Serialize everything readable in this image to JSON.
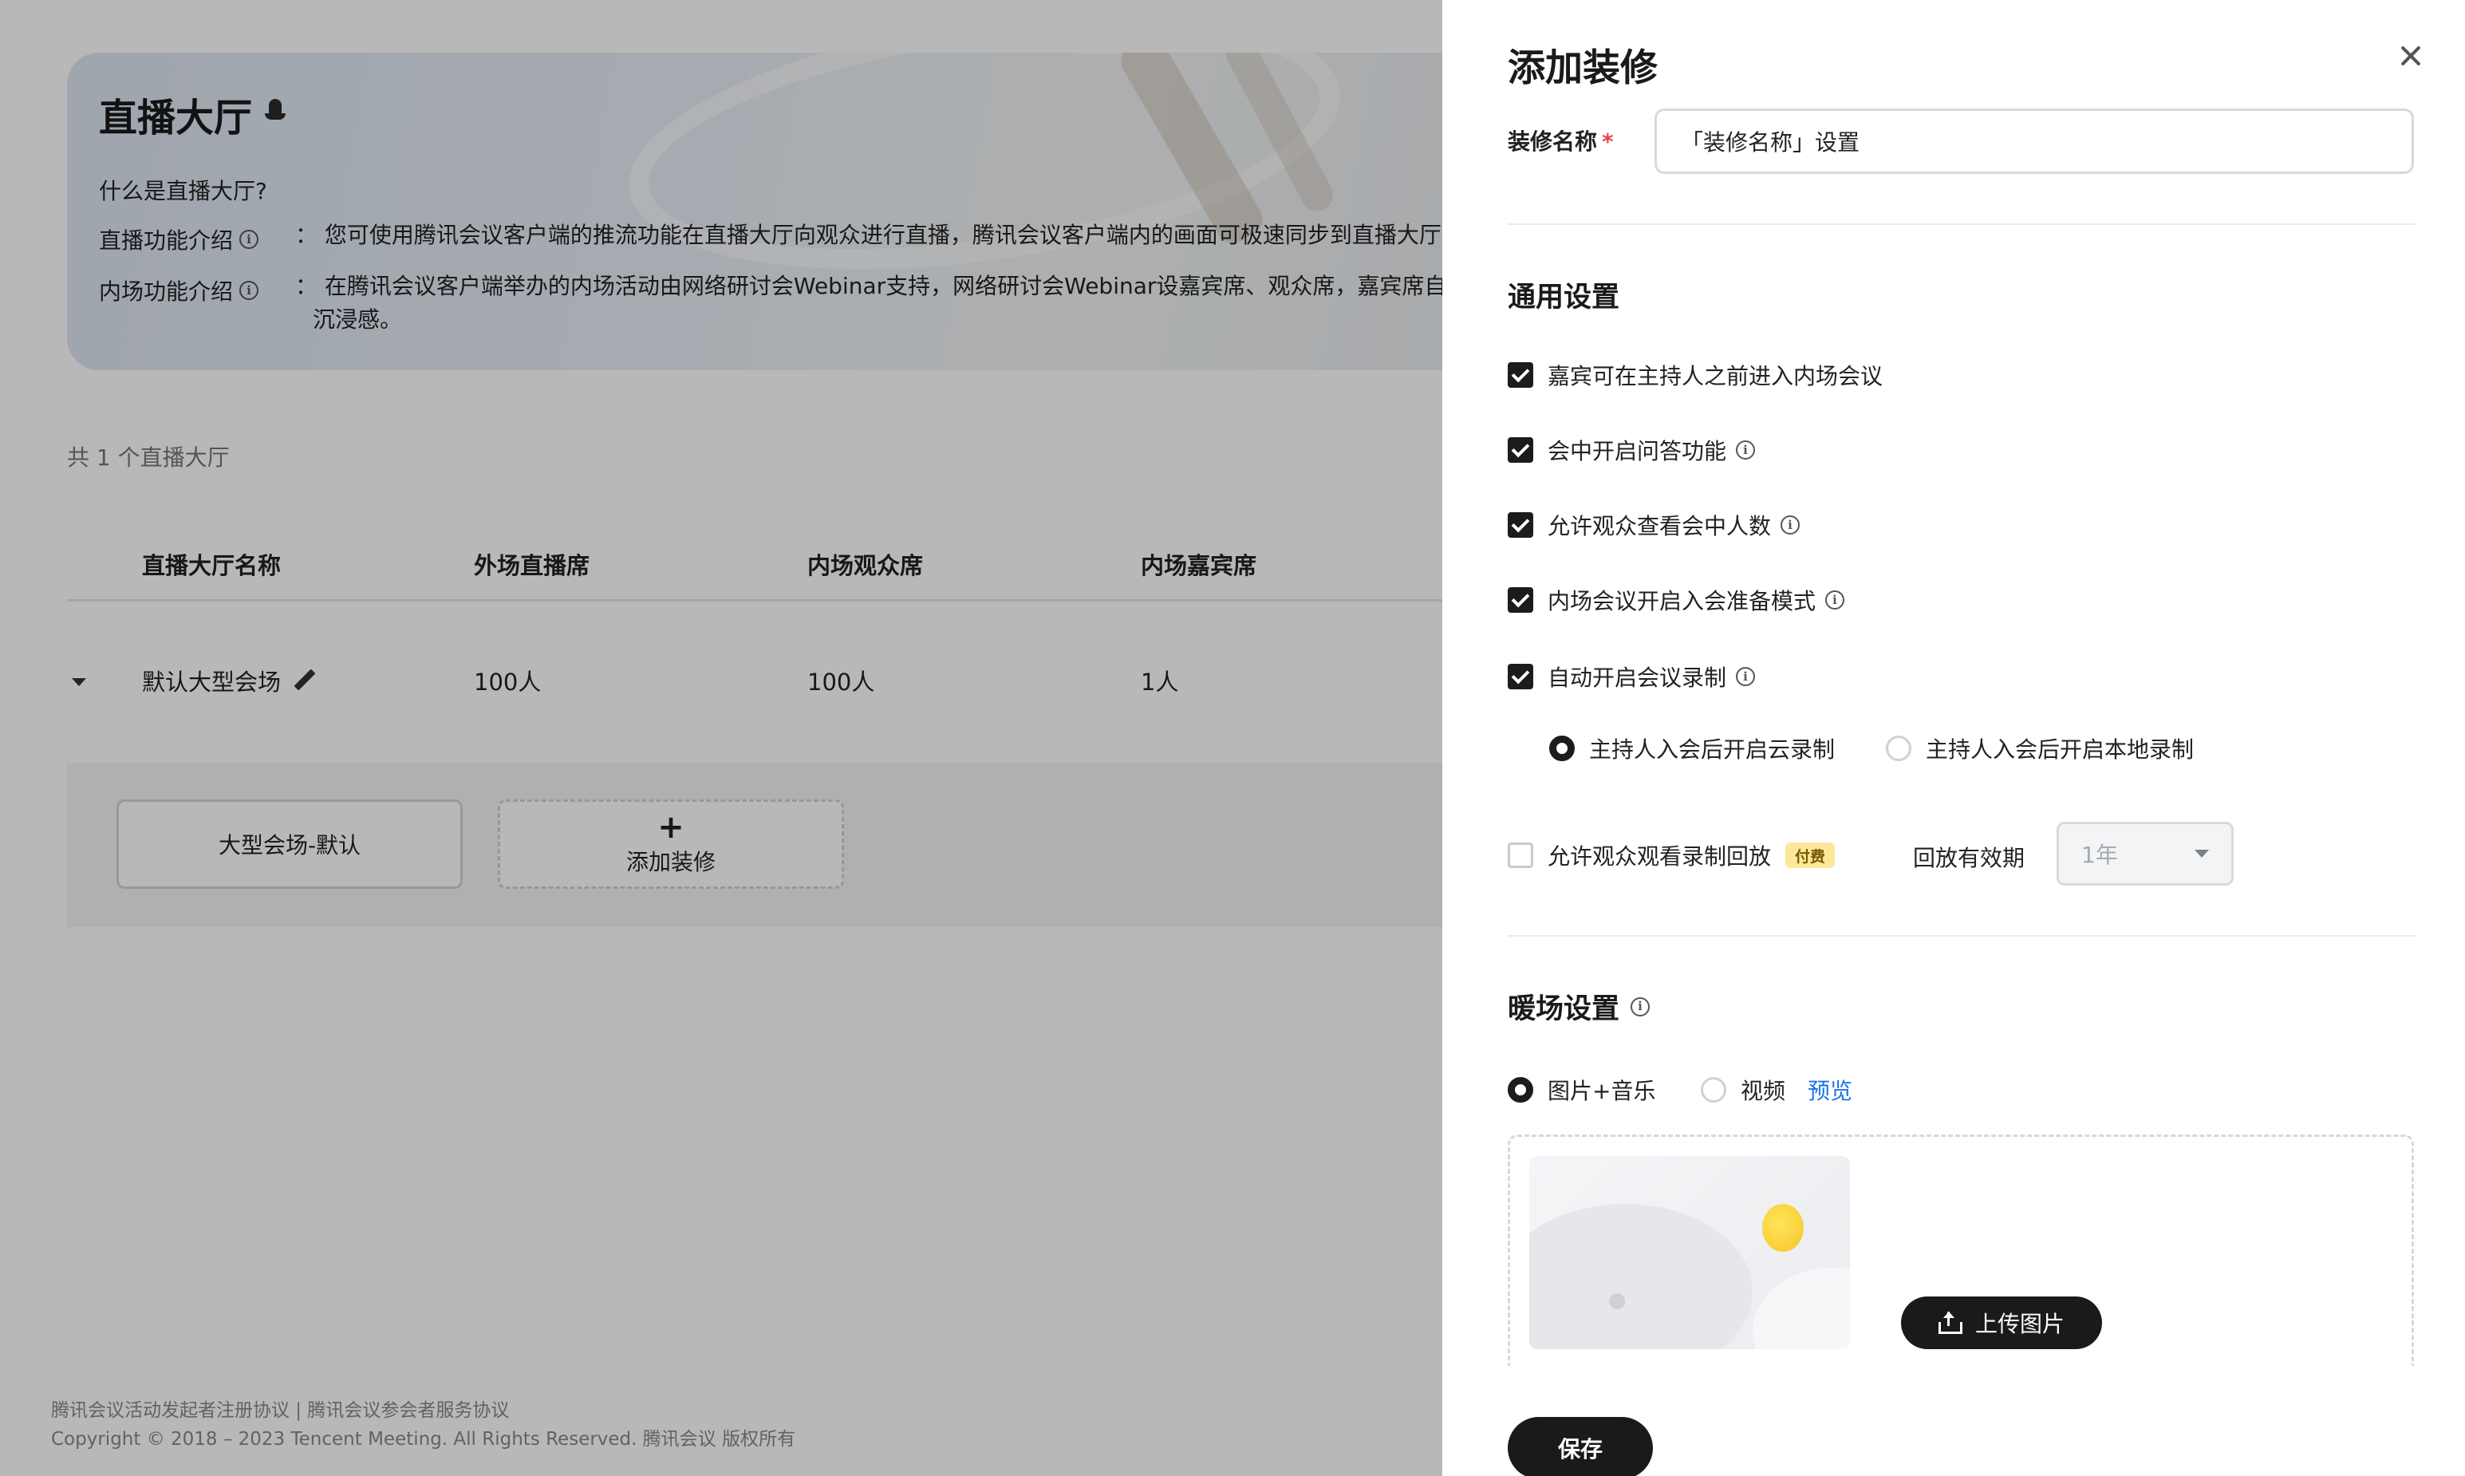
{
  "background_page": {
    "banner": {
      "title": "直播大厅",
      "question": "什么是直播大厅?",
      "live_intro_label": "直播功能介绍",
      "live_intro_text": "：  您可使用腾讯会议客户端的推流功能在直播大厅向观众进行直播，腾讯会议客户端内的画面可极速同步到直播大厅，：",
      "inner_intro_label": "内场功能介绍",
      "inner_intro_text_1": "：  在腾讯会议客户端举办的内场活动由网络研讨会Webinar支持，网络研讨会Webinar设嘉宾席、观众席，嘉宾席自由打",
      "inner_intro_text_2": "沉浸感。"
    },
    "total_count": "共 1 个直播大厅",
    "table": {
      "headers": [
        "直播大厅名称",
        "外场直播席",
        "内场观众席",
        "内场嘉宾席"
      ],
      "rows": [
        {
          "name": "默认大型会场",
          "outer": "100人",
          "inner_audience": "100人",
          "inner_guest": "1人"
        }
      ]
    },
    "decorations": {
      "existing": "大型会场-默认",
      "add_label": "添加装修",
      "add_symbol": "+"
    },
    "footer": {
      "links": "腾讯会议活动发起者注册协议 | 腾讯会议参会者服务协议",
      "copyright": "Copyright © 2018 – 2023 Tencent Meeting. All Rights Reserved. 腾讯会议 版权所有"
    }
  },
  "drawer": {
    "title": "添加装修",
    "name_label": "装修名称",
    "required_mark": "*",
    "name_value": "「装修名称」设置",
    "general_settings": {
      "title": "通用设置",
      "options": [
        {
          "label": "嘉宾可在主持人之前进入内场会议",
          "checked": true,
          "info": false
        },
        {
          "label": "会中开启问答功能",
          "checked": true,
          "info": true
        },
        {
          "label": "允许观众查看会中人数",
          "checked": true,
          "info": true
        },
        {
          "label": "内场会议开启入会准备模式",
          "checked": true,
          "info": true
        },
        {
          "label": "自动开启会议录制",
          "checked": true,
          "info": true
        }
      ],
      "record_modes": [
        {
          "label": "主持人入会后开启云录制",
          "selected": true
        },
        {
          "label": "主持人入会后开启本地录制",
          "selected": false
        }
      ],
      "playback": {
        "label": "允许观众观看录制回放",
        "checked": false,
        "badge": "付费",
        "validity_label": "回放有效期",
        "validity_value": "1年"
      }
    },
    "warmup_settings": {
      "title": "暖场设置",
      "modes": [
        {
          "label": "图片+音乐",
          "selected": true
        },
        {
          "label": "视频",
          "selected": false
        }
      ],
      "preview_link": "预览",
      "upload_label": "上传图片"
    },
    "save_label": "保存"
  },
  "colors": {
    "accent_dark": "#1a1a1a",
    "link_blue": "#1a73e8",
    "required_red": "#e5484d",
    "badge_yellow": "#fde79a"
  }
}
